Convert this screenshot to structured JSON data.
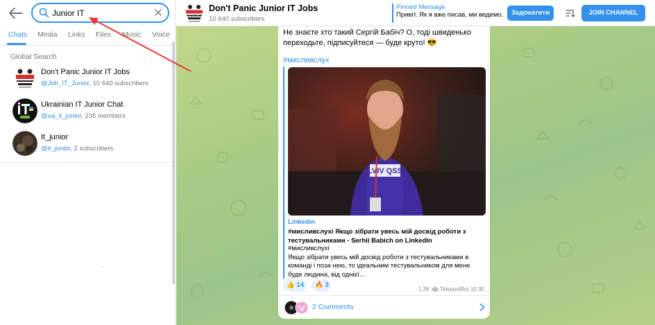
{
  "search": {
    "value": "Junior IT"
  },
  "tabs": [
    {
      "label": "Chats",
      "active": true
    },
    {
      "label": "Media",
      "active": false
    },
    {
      "label": "Links",
      "active": false
    },
    {
      "label": "Files",
      "active": false
    },
    {
      "label": "Music",
      "active": false
    },
    {
      "label": "Voice",
      "active": false
    }
  ],
  "global_search": {
    "title": "Global Search",
    "results": [
      {
        "name": "Don't Panic Junior IT Jobs",
        "handle": "@Job_IT_Junior",
        "count": ", 10 640 subscribers"
      },
      {
        "name": "Ukrainian IT Junior Chat",
        "handle": "@ua_it_junior",
        "count": ", 235 members"
      },
      {
        "name": "It_junior",
        "handle": "@it_junior",
        "count": ", 2 subscribers"
      }
    ]
  },
  "channel": {
    "title": "Don't Panic Junior IT Jobs",
    "subscribers": "10 640 subscribers",
    "pinned_label": "Pinned Message",
    "pinned_text": "Привіт. Як я вже писав, ми ведемо...",
    "donate_label": "Задонатити",
    "join_label": "JOIN CHANNEL"
  },
  "message": {
    "text": "Не знаєте хто такий Сергій Бабіч? О, тоді швиденько переходьте, підписуйтеся — буде круто! 😎",
    "hashtag": "#мисливслух",
    "preview": {
      "site": "Linkedin",
      "title": "#мисливслухі  Якщо зібрати увесь мій досвід роботи з тестувальниками - Serhii Babich on LinkedIn",
      "description": "#мисливслухі\nЯкщо зібрати увесь мій досвід роботи з тестувальниками в команді і поза нею, то ідеальним тестувальником для мене буде людина, від однієї...",
      "shirt_text": "LVIV QSS"
    },
    "reactions": [
      {
        "emoji": "👍",
        "count": "14"
      },
      {
        "emoji": "🔥",
        "count": "3"
      }
    ],
    "views": "1,3K",
    "author": "TelepostBot",
    "time": "10:30",
    "comments_label": "2 Comments"
  },
  "colors": {
    "accent": "#3390ec",
    "annotation": "#e53935",
    "chat_bg": "#b3cf88"
  },
  "icons": [
    "back-arrow-icon",
    "search-icon",
    "clear-icon",
    "filter-icon",
    "chevron-right-icon",
    "eye-icon"
  ]
}
